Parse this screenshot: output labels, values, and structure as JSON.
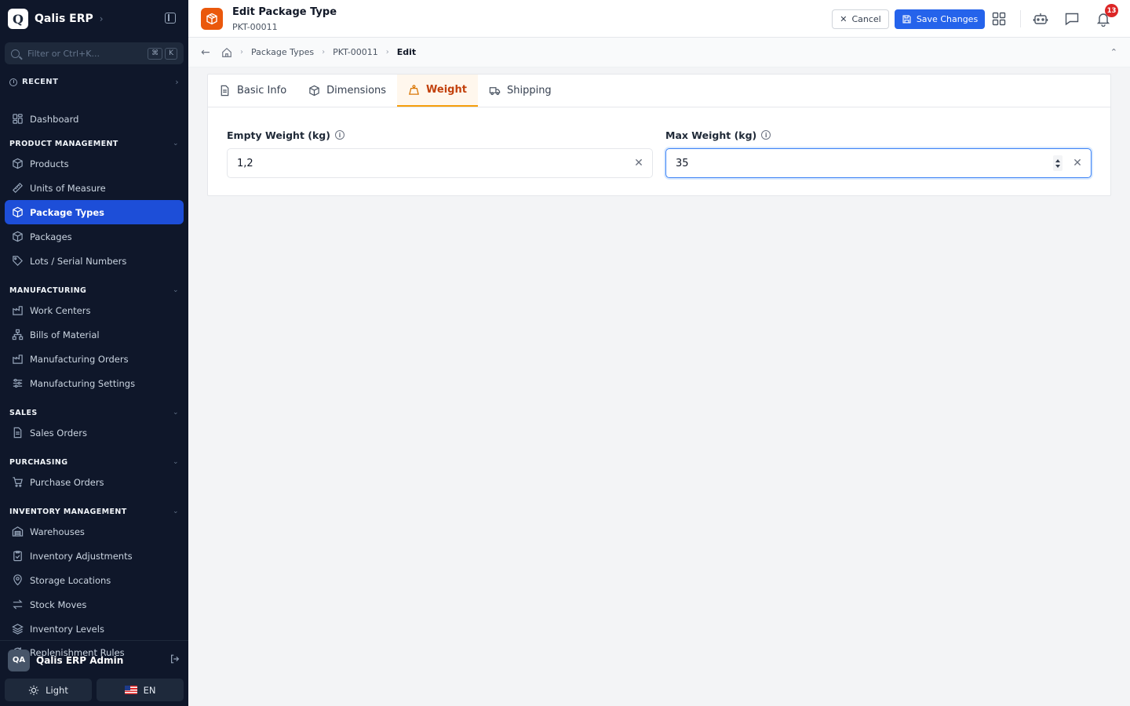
{
  "brand": {
    "logo_letter": "Q",
    "name": "Qalis ERP"
  },
  "filter": {
    "placeholder": "Filter or Ctrl+K...",
    "key1": "⌘",
    "key2": "K"
  },
  "recent_label": "RECENT",
  "nav": {
    "dashboard": "Dashboard",
    "sections": [
      {
        "title": "PRODUCT MANAGEMENT",
        "items": [
          "Products",
          "Units of Measure",
          "Package Types",
          "Packages",
          "Lots / Serial Numbers"
        ]
      },
      {
        "title": "MANUFACTURING",
        "items": [
          "Work Centers",
          "Bills of Material",
          "Manufacturing Orders",
          "Manufacturing Settings"
        ]
      },
      {
        "title": "SALES",
        "items": [
          "Sales Orders"
        ]
      },
      {
        "title": "PURCHASING",
        "items": [
          "Purchase Orders"
        ]
      },
      {
        "title": "INVENTORY MANAGEMENT",
        "items": [
          "Warehouses",
          "Inventory Adjustments",
          "Storage Locations",
          "Stock Moves",
          "Inventory Levels",
          "Replenishment Rules"
        ]
      }
    ],
    "active_item": "Package Types"
  },
  "user": {
    "initials": "QA",
    "name": "Qalis ERP Admin"
  },
  "bottom": {
    "theme_label": "Light",
    "lang_label": "EN"
  },
  "header": {
    "title": "Edit Package Type",
    "subtitle": "PKT-00011",
    "cancel_label": "Cancel",
    "save_label": "Save Changes",
    "notification_count": "13"
  },
  "breadcrumb": {
    "item1": "Package Types",
    "item2": "PKT-00011",
    "current": "Edit"
  },
  "tabs": [
    {
      "label": "Basic Info",
      "icon": "file-icon"
    },
    {
      "label": "Dimensions",
      "icon": "box-icon"
    },
    {
      "label": "Weight",
      "icon": "weight-icon",
      "active": true
    },
    {
      "label": "Shipping",
      "icon": "truck-icon"
    }
  ],
  "fields": {
    "empty_weight": {
      "label": "Empty Weight (kg)",
      "value": "1,2"
    },
    "max_weight": {
      "label": "Max Weight (kg)",
      "value": "35"
    }
  },
  "colors": {
    "accent": "#2563eb",
    "sidebar_bg": "#0f172a",
    "active_tab": "#c2410c",
    "brand_orange": "#ea580c"
  }
}
